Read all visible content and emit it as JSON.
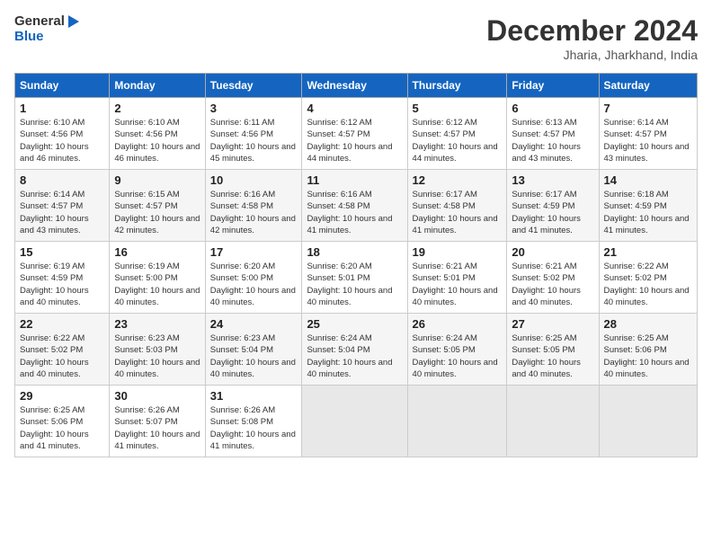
{
  "logo": {
    "line1": "General",
    "line2": "Blue"
  },
  "title": "December 2024",
  "subtitle": "Jharia, Jharkhand, India",
  "days_of_week": [
    "Sunday",
    "Monday",
    "Tuesday",
    "Wednesday",
    "Thursday",
    "Friday",
    "Saturday"
  ],
  "weeks": [
    [
      {
        "day": "1",
        "sunrise": "6:10 AM",
        "sunset": "4:56 PM",
        "daylight": "10 hours and 46 minutes."
      },
      {
        "day": "2",
        "sunrise": "6:10 AM",
        "sunset": "4:56 PM",
        "daylight": "10 hours and 46 minutes."
      },
      {
        "day": "3",
        "sunrise": "6:11 AM",
        "sunset": "4:56 PM",
        "daylight": "10 hours and 45 minutes."
      },
      {
        "day": "4",
        "sunrise": "6:12 AM",
        "sunset": "4:57 PM",
        "daylight": "10 hours and 44 minutes."
      },
      {
        "day": "5",
        "sunrise": "6:12 AM",
        "sunset": "4:57 PM",
        "daylight": "10 hours and 44 minutes."
      },
      {
        "day": "6",
        "sunrise": "6:13 AM",
        "sunset": "4:57 PM",
        "daylight": "10 hours and 43 minutes."
      },
      {
        "day": "7",
        "sunrise": "6:14 AM",
        "sunset": "4:57 PM",
        "daylight": "10 hours and 43 minutes."
      }
    ],
    [
      {
        "day": "8",
        "sunrise": "6:14 AM",
        "sunset": "4:57 PM",
        "daylight": "10 hours and 43 minutes."
      },
      {
        "day": "9",
        "sunrise": "6:15 AM",
        "sunset": "4:57 PM",
        "daylight": "10 hours and 42 minutes."
      },
      {
        "day": "10",
        "sunrise": "6:16 AM",
        "sunset": "4:58 PM",
        "daylight": "10 hours and 42 minutes."
      },
      {
        "day": "11",
        "sunrise": "6:16 AM",
        "sunset": "4:58 PM",
        "daylight": "10 hours and 41 minutes."
      },
      {
        "day": "12",
        "sunrise": "6:17 AM",
        "sunset": "4:58 PM",
        "daylight": "10 hours and 41 minutes."
      },
      {
        "day": "13",
        "sunrise": "6:17 AM",
        "sunset": "4:59 PM",
        "daylight": "10 hours and 41 minutes."
      },
      {
        "day": "14",
        "sunrise": "6:18 AM",
        "sunset": "4:59 PM",
        "daylight": "10 hours and 41 minutes."
      }
    ],
    [
      {
        "day": "15",
        "sunrise": "6:19 AM",
        "sunset": "4:59 PM",
        "daylight": "10 hours and 40 minutes."
      },
      {
        "day": "16",
        "sunrise": "6:19 AM",
        "sunset": "5:00 PM",
        "daylight": "10 hours and 40 minutes."
      },
      {
        "day": "17",
        "sunrise": "6:20 AM",
        "sunset": "5:00 PM",
        "daylight": "10 hours and 40 minutes."
      },
      {
        "day": "18",
        "sunrise": "6:20 AM",
        "sunset": "5:01 PM",
        "daylight": "10 hours and 40 minutes."
      },
      {
        "day": "19",
        "sunrise": "6:21 AM",
        "sunset": "5:01 PM",
        "daylight": "10 hours and 40 minutes."
      },
      {
        "day": "20",
        "sunrise": "6:21 AM",
        "sunset": "5:02 PM",
        "daylight": "10 hours and 40 minutes."
      },
      {
        "day": "21",
        "sunrise": "6:22 AM",
        "sunset": "5:02 PM",
        "daylight": "10 hours and 40 minutes."
      }
    ],
    [
      {
        "day": "22",
        "sunrise": "6:22 AM",
        "sunset": "5:02 PM",
        "daylight": "10 hours and 40 minutes."
      },
      {
        "day": "23",
        "sunrise": "6:23 AM",
        "sunset": "5:03 PM",
        "daylight": "10 hours and 40 minutes."
      },
      {
        "day": "24",
        "sunrise": "6:23 AM",
        "sunset": "5:04 PM",
        "daylight": "10 hours and 40 minutes."
      },
      {
        "day": "25",
        "sunrise": "6:24 AM",
        "sunset": "5:04 PM",
        "daylight": "10 hours and 40 minutes."
      },
      {
        "day": "26",
        "sunrise": "6:24 AM",
        "sunset": "5:05 PM",
        "daylight": "10 hours and 40 minutes."
      },
      {
        "day": "27",
        "sunrise": "6:25 AM",
        "sunset": "5:05 PM",
        "daylight": "10 hours and 40 minutes."
      },
      {
        "day": "28",
        "sunrise": "6:25 AM",
        "sunset": "5:06 PM",
        "daylight": "10 hours and 40 minutes."
      }
    ],
    [
      {
        "day": "29",
        "sunrise": "6:25 AM",
        "sunset": "5:06 PM",
        "daylight": "10 hours and 41 minutes."
      },
      {
        "day": "30",
        "sunrise": "6:26 AM",
        "sunset": "5:07 PM",
        "daylight": "10 hours and 41 minutes."
      },
      {
        "day": "31",
        "sunrise": "6:26 AM",
        "sunset": "5:08 PM",
        "daylight": "10 hours and 41 minutes."
      },
      null,
      null,
      null,
      null
    ]
  ]
}
